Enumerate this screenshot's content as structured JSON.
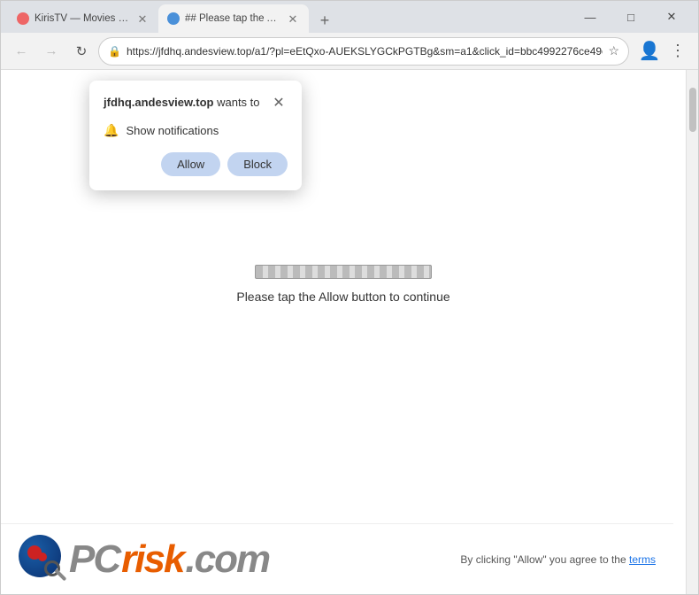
{
  "browser": {
    "tabs": [
      {
        "id": "tab1",
        "title": "KirisTV — Movies and Series D...",
        "active": false,
        "favicon": "red"
      },
      {
        "id": "tab2",
        "title": "## Please tap the Allow button...",
        "active": true,
        "favicon": "blue"
      }
    ],
    "new_tab_label": "+",
    "window_controls": {
      "minimize": "—",
      "maximize": "□",
      "close": "✕"
    },
    "nav": {
      "back": "←",
      "forward": "→",
      "reload": "↻"
    },
    "address": "https://jfdhq.andesview.top/a1/?pl=eEtQxo-AUEKSLYGCkPGTBg&sm=a1&click_id=bbc4992276ce49e3...",
    "address_placeholder": ""
  },
  "popup": {
    "domain": "jfdhq.andesview.top",
    "title_suffix": " wants to",
    "close_label": "✕",
    "notification_text": "Show notifications",
    "allow_button": "Allow",
    "block_button": "Block"
  },
  "page": {
    "instruction": "Please tap the Allow button to continue"
  },
  "footer": {
    "prefix_text": "By clicking \"Allow\" you agree to the ",
    "link_text": "terms"
  },
  "logo": {
    "pc_text": "PC",
    "risk_text": "risk",
    "dotcom_text": ".com"
  }
}
